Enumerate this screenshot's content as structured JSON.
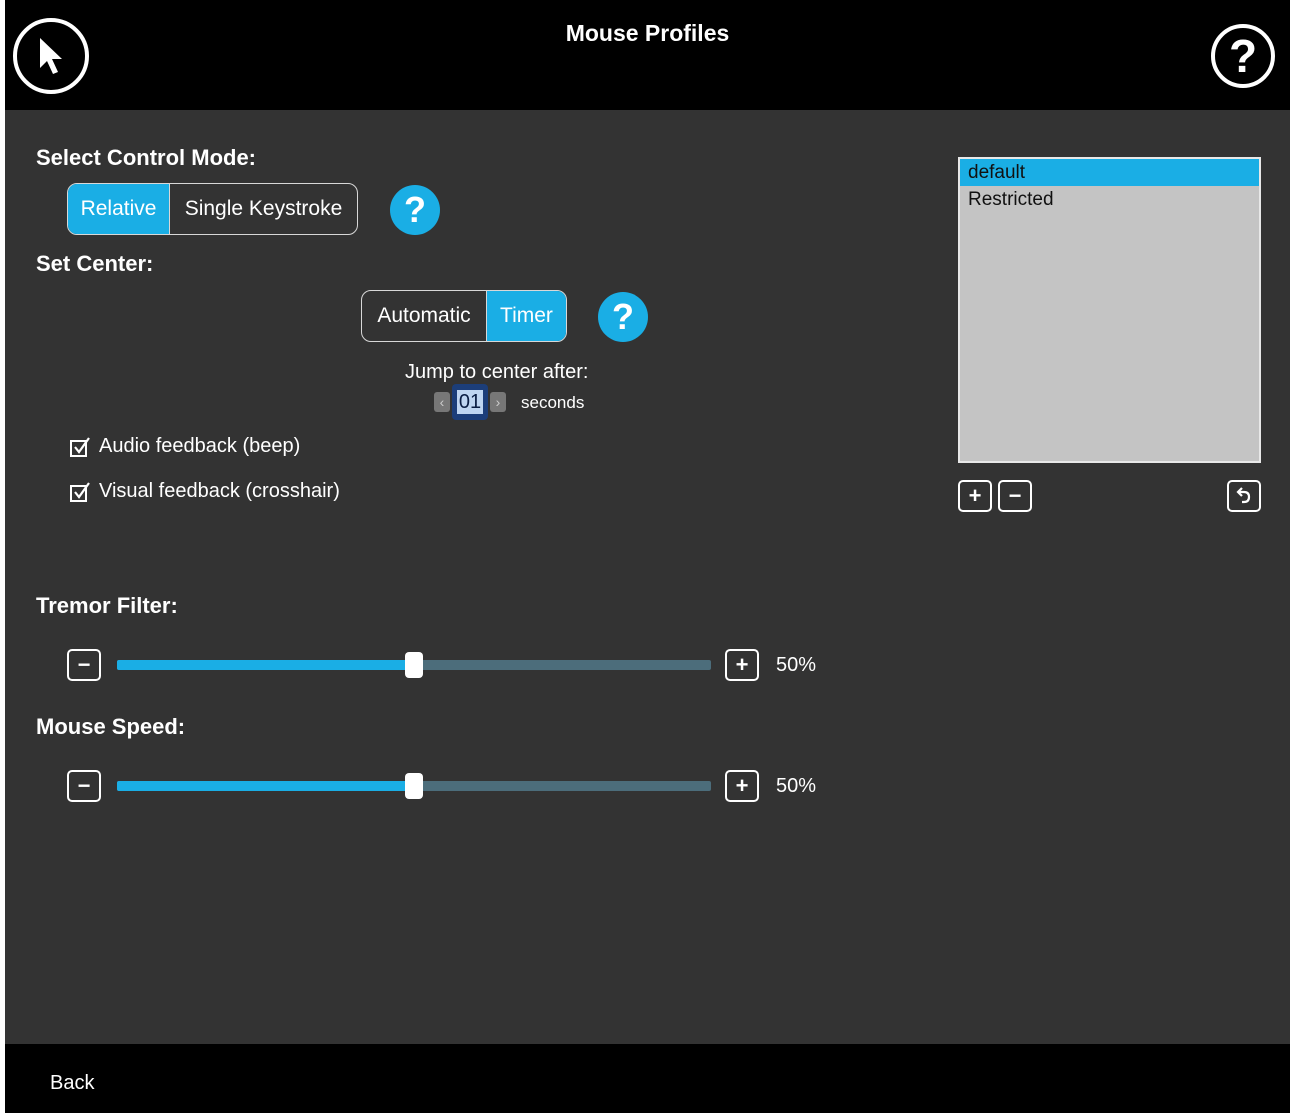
{
  "header": {
    "title": "Mouse Profiles",
    "help_glyph": "?",
    "app_icon": "mouse-pointer-icon",
    "help_icon": "help-circle-icon"
  },
  "control_mode": {
    "label": "Select Control Mode:",
    "options": [
      "Relative",
      "Single Keystroke"
    ],
    "selected": "Relative",
    "help_glyph": "?"
  },
  "set_center": {
    "label": "Set Center:",
    "options": [
      "Automatic",
      "Timer"
    ],
    "selected": "Timer",
    "help_glyph": "?",
    "jump_label": "Jump to center after:",
    "stepper_value": "01",
    "stepper_left": "‹",
    "stepper_right": "›",
    "unit": "seconds"
  },
  "feedback": {
    "audio_label": "Audio feedback (beep)",
    "audio_checked": true,
    "visual_label": "Visual feedback (crosshair)",
    "visual_checked": true
  },
  "tremor_filter": {
    "label": "Tremor Filter:",
    "value": 0.5,
    "display": "50%",
    "minus": "−",
    "plus": "+"
  },
  "mouse_speed": {
    "label": "Mouse Speed:",
    "value": 0.5,
    "display": "50%",
    "minus": "−",
    "plus": "+"
  },
  "profiles": {
    "items": [
      "default",
      "Restricted"
    ],
    "selected": "default",
    "add": "+",
    "remove": "−",
    "revert_icon": "undo-icon"
  },
  "footer": {
    "back_label": "Back"
  },
  "colors": {
    "accent": "#1aaee5",
    "background": "#333333",
    "bars": "#000000",
    "track": "#4c6d7b"
  }
}
